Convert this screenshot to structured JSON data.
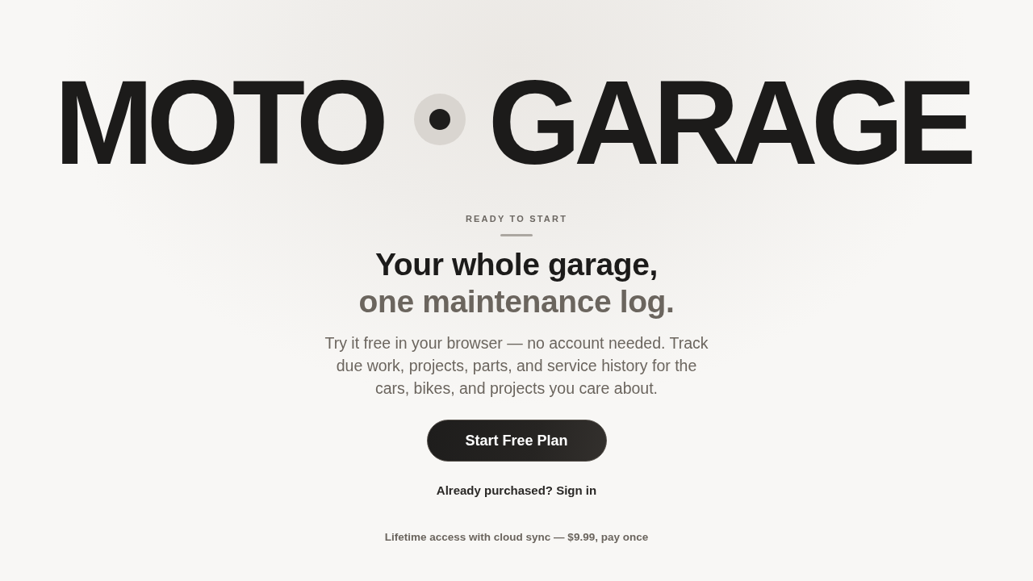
{
  "brand": {
    "words": [
      "MOTO",
      "GARAGE"
    ]
  },
  "eyebrow": "READY TO START",
  "headline": {
    "lines": [
      "Your whole garage,",
      "one maintenance log."
    ]
  },
  "description": "Try it free in your browser — no account needed. Track due work, projects, parts, and service history for the cars, bikes, and projects you care about.",
  "primary_button": "Start Free Plan",
  "sign_in_link": "Already purchased? Sign in",
  "pricing_note": "Lifetime access with cloud sync — $9.99, pay once"
}
